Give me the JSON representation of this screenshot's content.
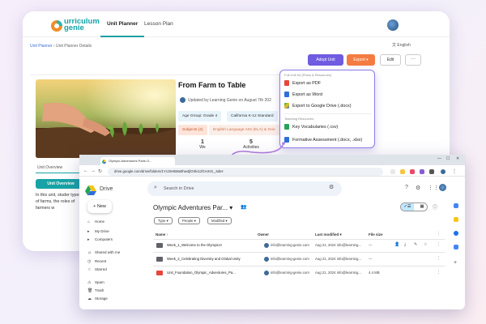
{
  "curriculum_app": {
    "logo": {
      "line1": "urriculum",
      "line2": "genie"
    },
    "tabs": [
      {
        "label": "Unit Planner"
      },
      {
        "label": "Lesson Plan"
      }
    ],
    "language": "English",
    "breadcrumb": {
      "root": "Unit Planner",
      "sep": "›",
      "current": "Unit Planner Details"
    },
    "actions": {
      "adopt": "Adopt Unit",
      "export": "Export ▾",
      "edit": "Edit",
      "more": "···"
    },
    "unit": {
      "title": "From Farm to Table",
      "updated": "Updated by Learning Genie on August 7th 202",
      "age_group": "Age Group: Grade 4",
      "standard": "California K-12 Standard",
      "subject_label": "Subjects (2)",
      "subject_value": "English Language Arts (ELA) & Scie",
      "stat1_value": "1",
      "stat1_label": "We",
      "stat2_value": "5",
      "stat2_label": "Activities"
    },
    "overview_tab": "Unit Overview",
    "overview_pill": "Unit Overview",
    "intro_text": "In this unit, studer types of farms, the roles of farmers w"
  },
  "export_menu": {
    "heading1": "Full Unit Kit (Plans & Resources)",
    "items1": [
      {
        "label": "Export as PDF",
        "color": "#e9463b"
      },
      {
        "label": "Export as Word",
        "color": "#2f6fd6"
      },
      {
        "label": "Export to Google Drive (.docx)",
        "color": "#27a257"
      }
    ],
    "heading2": "Teaching Resources",
    "items2": [
      {
        "label": "Key Vocabularies (.csv)",
        "color": "#27a257"
      },
      {
        "label": "Formative Assessment (.docx, .xlsx)",
        "color": "#2f6fd6"
      }
    ]
  },
  "browser": {
    "tab_title": "Olympic Adventures Paris O...",
    "url": "drive.google.com/drive/folders/1Ycz5H6Ma0hw4jlOXle12fzArKG_JxbH",
    "win_controls": {
      "min": "—",
      "max": "☐",
      "close": "✕"
    }
  },
  "drive": {
    "app_name": "Drive",
    "search_placeholder": "Search in Drive",
    "new_button": "New",
    "nav": [
      {
        "icon": "⌂",
        "label": "Home"
      },
      {
        "icon": "▸",
        "label": "My Drive"
      },
      {
        "icon": "▸",
        "label": "Computers"
      },
      {
        "icon": "☺",
        "label": "Shared with me"
      },
      {
        "icon": "◷",
        "label": "Recent"
      },
      {
        "icon": "☆",
        "label": "Starred"
      },
      {
        "icon": "⚠",
        "label": "Spam"
      },
      {
        "icon": "🗑",
        "label": "Trash"
      },
      {
        "icon": "☁",
        "label": "Storage"
      }
    ],
    "folder_title": "Olympic Adventures Par... ▾",
    "filters": [
      "Type ▾",
      "People ▾",
      "Modified ▾"
    ],
    "columns": {
      "name": "Name  ↑",
      "owner": "Owner",
      "modified": "Last modified  ▾",
      "size": "File size"
    },
    "rows": [
      {
        "name": "Week_1_Welcome to the Olympics!",
        "owner": "info@learning-genie.com",
        "modified": "Aug 21, 2024 info@learning...",
        "size": "—",
        "type": "folder"
      },
      {
        "name": "Week_2_Celebrating Diversity and Global Unity",
        "owner": "info@learning-genie.com",
        "modified": "Aug 21, 2024 info@learning...",
        "size": "—",
        "type": "folder"
      },
      {
        "name": "Unit_Foundation_Olympic_Adventures_Pa...",
        "owner": "info@learning-genie.com",
        "modified": "Aug 21, 2024 info@learning...",
        "size": "4.4 MB",
        "type": "pdf"
      }
    ]
  }
}
